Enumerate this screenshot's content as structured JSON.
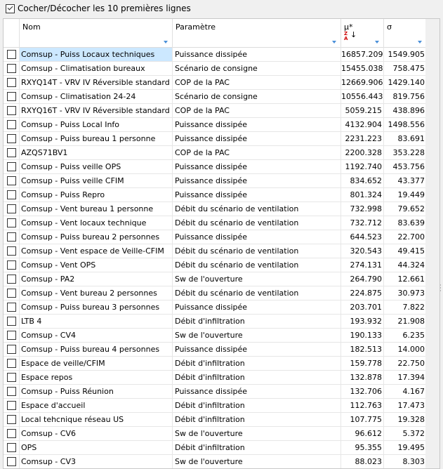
{
  "toolbar": {
    "select_top_label": "Cocher/Décocher les 10 premières lignes",
    "select_top_checked": true
  },
  "columns": {
    "name": "Nom",
    "parameter": "Paramètre",
    "mu": "μ*",
    "sigma": "σ",
    "sort_indicator": "Z A"
  },
  "rows": [
    {
      "name": "Comsup - Puiss Locaux techniques",
      "parameter": "Puissance dissipée",
      "mu": "16857.209",
      "sigma": "1549.905",
      "selected": true
    },
    {
      "name": "Comsup - Climatisation bureaux",
      "parameter": "Scénario de consigne",
      "mu": "15455.038",
      "sigma": "758.475"
    },
    {
      "name": "RXYQ14T - VRV IV Réversible standard",
      "parameter": "COP de la PAC",
      "mu": "12669.906",
      "sigma": "1429.140"
    },
    {
      "name": "Comsup - Climatisation 24-24",
      "parameter": "Scénario de consigne",
      "mu": "10556.443",
      "sigma": "819.756"
    },
    {
      "name": "RXYQ16T - VRV IV Réversible standard",
      "parameter": "COP de la PAC",
      "mu": "5059.215",
      "sigma": "438.896"
    },
    {
      "name": "Comsup - Puiss Local Info",
      "parameter": "Puissance dissipée",
      "mu": "4132.904",
      "sigma": "1498.556"
    },
    {
      "name": "Comsup - Puiss bureau 1 personne",
      "parameter": "Puissance dissipée",
      "mu": "2231.223",
      "sigma": "83.691"
    },
    {
      "name": "AZQS71BV1",
      "parameter": "COP de la PAC",
      "mu": "2200.328",
      "sigma": "353.228"
    },
    {
      "name": "Comsup - Puiss veille OPS",
      "parameter": "Puissance dissipée",
      "mu": "1192.740",
      "sigma": "453.756"
    },
    {
      "name": "Comsup - Puiss veille CFIM",
      "parameter": "Puissance dissipée",
      "mu": "834.652",
      "sigma": "43.377"
    },
    {
      "name": "Comsup - Puiss Repro",
      "parameter": "Puissance dissipée",
      "mu": "801.324",
      "sigma": "19.449"
    },
    {
      "name": "Comsup - Vent bureau 1 personne",
      "parameter": "Débit du scénario de ventilation",
      "mu": "732.998",
      "sigma": "79.652"
    },
    {
      "name": "Comsup - Vent locaux technique",
      "parameter": "Débit du scénario de ventilation",
      "mu": "732.712",
      "sigma": "83.639"
    },
    {
      "name": "Comsup - Puiss bureau 2 personnes",
      "parameter": "Puissance dissipée",
      "mu": "644.523",
      "sigma": "22.700"
    },
    {
      "name": "Comsup - Vent espace de Veille-CFIM",
      "parameter": "Débit du scénario de ventilation",
      "mu": "320.543",
      "sigma": "49.415"
    },
    {
      "name": "Comsup - Vent OPS",
      "parameter": "Débit du scénario de ventilation",
      "mu": "274.131",
      "sigma": "44.324"
    },
    {
      "name": "Comsup - PA2",
      "parameter": "Sw de l'ouverture",
      "mu": "264.790",
      "sigma": "12.661"
    },
    {
      "name": "Comsup - Vent bureau 2 personnes",
      "parameter": "Débit du scénario de ventilation",
      "mu": "224.875",
      "sigma": "30.973"
    },
    {
      "name": "Comsup - Puiss bureau 3 personnes",
      "parameter": "Puissance dissipée",
      "mu": "203.701",
      "sigma": "7.822"
    },
    {
      "name": "LTB 4",
      "parameter": "Débit d'infiltration",
      "mu": "193.932",
      "sigma": "21.908"
    },
    {
      "name": "Comsup - CV4",
      "parameter": "Sw de l'ouverture",
      "mu": "190.133",
      "sigma": "6.235"
    },
    {
      "name": "Comsup - Puiss bureau 4 personnes",
      "parameter": "Puissance dissipée",
      "mu": "182.513",
      "sigma": "14.000"
    },
    {
      "name": "Espace de veille/CFIM",
      "parameter": "Débit d'infiltration",
      "mu": "159.778",
      "sigma": "22.750"
    },
    {
      "name": "Espace repos",
      "parameter": "Débit d'infiltration",
      "mu": "132.878",
      "sigma": "17.394"
    },
    {
      "name": "Comsup - Puiss Réunion",
      "parameter": "Puissance dissipée",
      "mu": "132.706",
      "sigma": "4.167"
    },
    {
      "name": "Espace d'accueil",
      "parameter": "Débit d'infiltration",
      "mu": "112.763",
      "sigma": "17.473"
    },
    {
      "name": "Local tehcnique réseau US",
      "parameter": "Débit d'infiltration",
      "mu": "107.775",
      "sigma": "19.328"
    },
    {
      "name": "Comsup - CV6",
      "parameter": "Sw de l'ouverture",
      "mu": "96.612",
      "sigma": "5.372"
    },
    {
      "name": "OPS",
      "parameter": "Débit d'infiltration",
      "mu": "95.355",
      "sigma": "19.495"
    },
    {
      "name": "Comsup - CV3",
      "parameter": "Sw de l'ouverture",
      "mu": "88.023",
      "sigma": "8.303"
    }
  ]
}
